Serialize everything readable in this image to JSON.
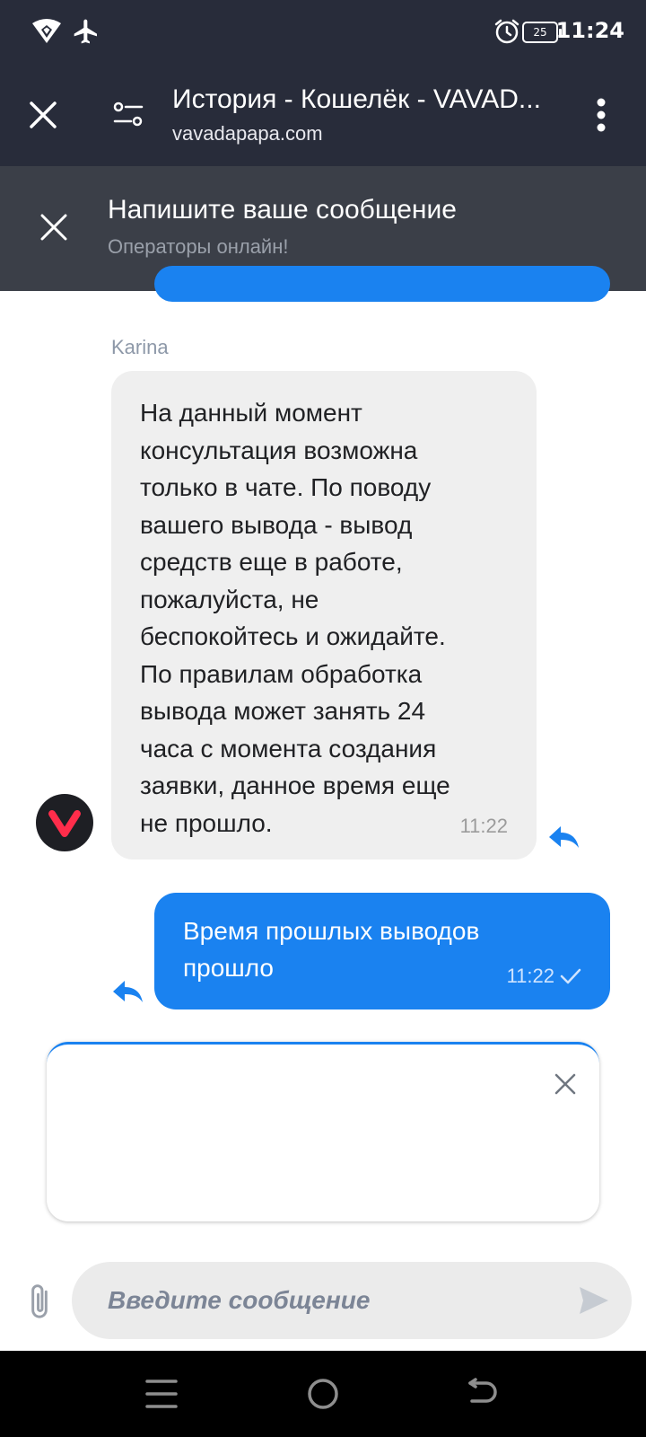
{
  "status_bar": {
    "time": "11:24",
    "battery": "25"
  },
  "browser": {
    "title": "История - Кошелёк - VAVAD...",
    "url": "vavadapapa.com"
  },
  "chat_header": {
    "title": "Напишите ваше сообщение",
    "subtitle": "Операторы онлайн!"
  },
  "messages": [
    {
      "direction": "incoming",
      "sender": "Karina",
      "text": "На данный момент\nконсультация возможна\nтолько в чате. По поводу\nвашего вывода - вывод\nсредств еще в работе,\nпожалуйста, не\nбеспокойтесь и ожидайте.\nПо правилам обработка\nвывода может занять 24\nчаса с момента создания\nзаявки, данное время еще\nне прошло.",
      "time": "11:22"
    },
    {
      "direction": "outgoing",
      "text": "Время прошлых выводов\nпрошло",
      "time": "11:22"
    }
  ],
  "composer": {
    "placeholder": "Введите сообщение"
  },
  "colors": {
    "accent": "#1a82f0",
    "header_dark": "#282c3a",
    "chat_header": "#3b3f48",
    "incoming_bubble": "#efefef",
    "brand_red": "#ff2d4b"
  },
  "icons": {
    "status": [
      "wifi-icon",
      "airplane-icon",
      "alarm-icon",
      "battery-icon"
    ],
    "browser": [
      "close-icon",
      "site-settings-icon",
      "more-vert-icon"
    ],
    "chat": [
      "close-icon",
      "reply-icon",
      "check-icon",
      "attach-icon",
      "send-icon"
    ],
    "nav": [
      "recents-icon",
      "home-icon",
      "back-icon"
    ]
  }
}
